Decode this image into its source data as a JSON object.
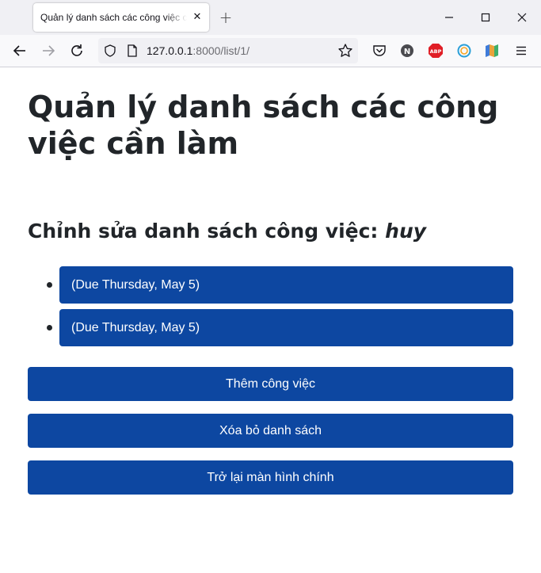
{
  "browser": {
    "tab_title": "Quản lý danh sách các công việc cần làm",
    "url_host": "127.0.0.1",
    "url_path": ":8000/list/1/",
    "icons": [
      "back-icon",
      "forward-icon",
      "reload-icon",
      "shield-icon",
      "page-icon",
      "bookmark-star-icon",
      "pocket-icon",
      "extension-n-icon",
      "adblock-icon",
      "extension-circle-icon",
      "reader-map-icon",
      "menu-icon"
    ]
  },
  "page": {
    "title": "Quản lý danh sách các công việc cần làm",
    "list_heading_prefix": "Chỉnh sửa danh sách công việc:",
    "list_name": "huy",
    "tasks": [
      {
        "label": "(Due Thursday, May 5)"
      },
      {
        "label": "(Due Thursday, May 5)"
      }
    ],
    "buttons": {
      "add_task": "Thêm công việc",
      "delete_list": "Xóa bỏ danh sách",
      "back_home": "Trở lại màn hình chính"
    }
  },
  "colors": {
    "accent": "#0d47a1",
    "text": "#212529"
  }
}
